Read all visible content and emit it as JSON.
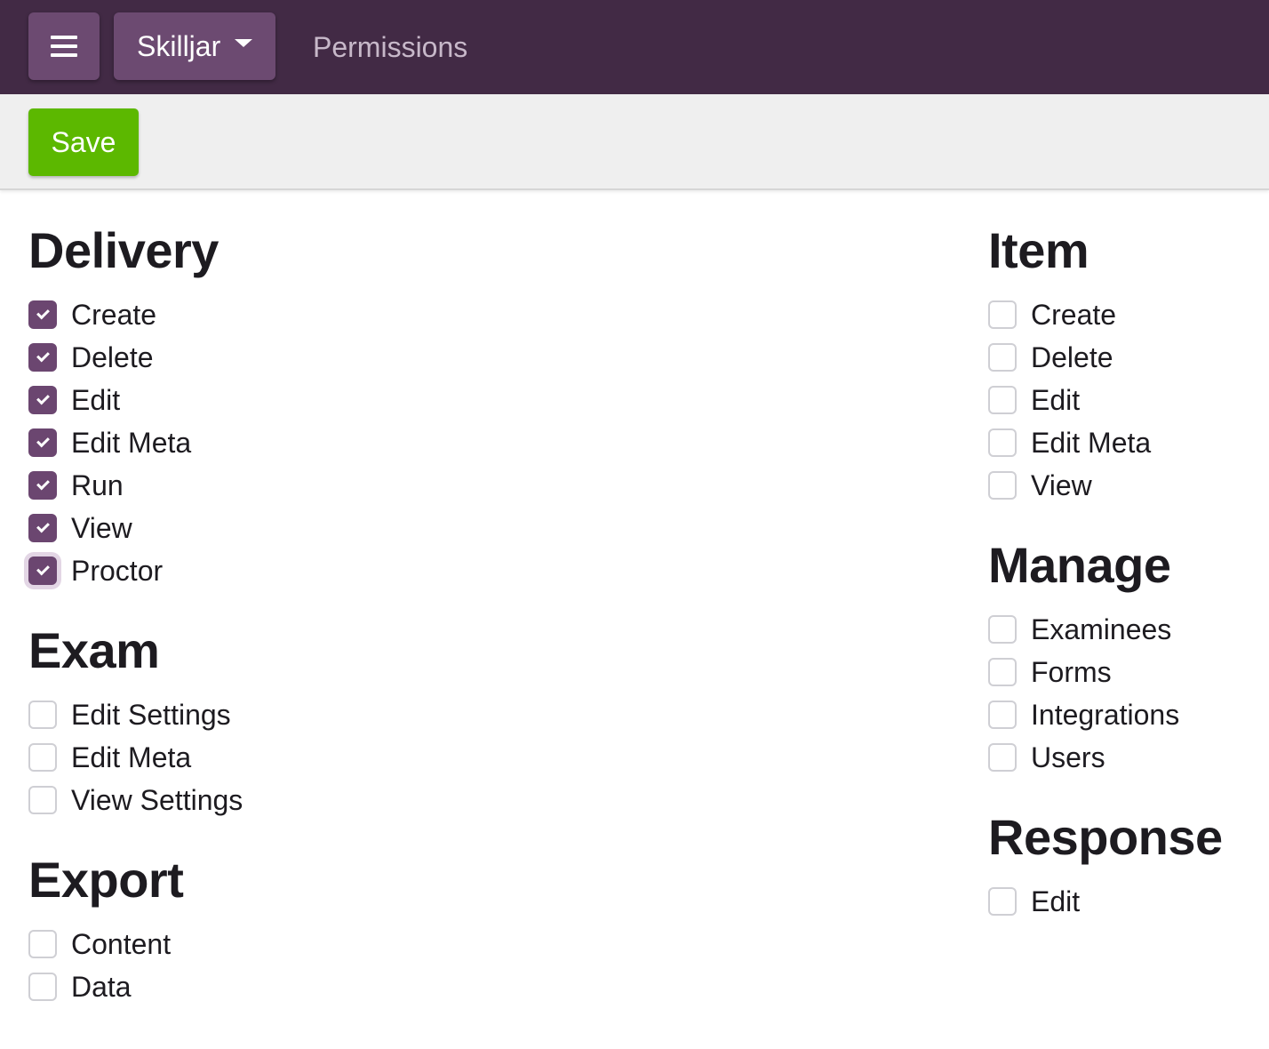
{
  "header": {
    "menu_icon": "hamburger-menu-icon",
    "org_name": "Skilljar",
    "breadcrumb": "Permissions",
    "colors": {
      "bar": "#422a45",
      "button": "#6c4a71",
      "breadcrumb": "#c7b8c9"
    }
  },
  "toolbar": {
    "save_label": "Save",
    "save_color": "#5cb800"
  },
  "sections": {
    "delivery": {
      "title": "Delivery",
      "options": [
        {
          "label": "Create",
          "checked": true
        },
        {
          "label": "Delete",
          "checked": true
        },
        {
          "label": "Edit",
          "checked": true
        },
        {
          "label": "Edit Meta",
          "checked": true
        },
        {
          "label": "Run",
          "checked": true
        },
        {
          "label": "View",
          "checked": true
        },
        {
          "label": "Proctor",
          "checked": true,
          "focused": true
        }
      ]
    },
    "exam": {
      "title": "Exam",
      "options": [
        {
          "label": "Edit Settings",
          "checked": false
        },
        {
          "label": "Edit Meta",
          "checked": false
        },
        {
          "label": "View Settings",
          "checked": false
        }
      ]
    },
    "export": {
      "title": "Export",
      "options": [
        {
          "label": "Content",
          "checked": false
        },
        {
          "label": "Data",
          "checked": false
        }
      ]
    },
    "item": {
      "title": "Item",
      "options": [
        {
          "label": "Create",
          "checked": false
        },
        {
          "label": "Delete",
          "checked": false
        },
        {
          "label": "Edit",
          "checked": false
        },
        {
          "label": "Edit Meta",
          "checked": false
        },
        {
          "label": "View",
          "checked": false
        }
      ]
    },
    "manage": {
      "title": "Manage",
      "options": [
        {
          "label": "Examinees",
          "checked": false
        },
        {
          "label": "Forms",
          "checked": false
        },
        {
          "label": "Integrations",
          "checked": false
        },
        {
          "label": "Users",
          "checked": false
        }
      ]
    },
    "response": {
      "title": "Response",
      "options": [
        {
          "label": "Edit",
          "checked": false
        }
      ]
    }
  },
  "checkbox_color": "#6b4670"
}
